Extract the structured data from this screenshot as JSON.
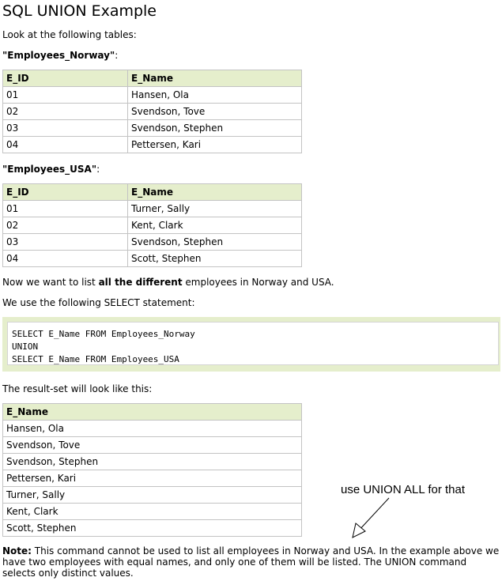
{
  "title": "SQL UNION Example",
  "intro": "Look at the following tables:",
  "table1": {
    "label": "\"Employees_Norway\"",
    "suffix": ":",
    "headers": [
      "E_ID",
      "E_Name"
    ],
    "rows": [
      [
        "01",
        "Hansen, Ola"
      ],
      [
        "02",
        "Svendson, Tove"
      ],
      [
        "03",
        "Svendson, Stephen"
      ],
      [
        "04",
        "Pettersen, Kari"
      ]
    ]
  },
  "table2": {
    "label": "\"Employees_USA\"",
    "suffix": ":",
    "headers": [
      "E_ID",
      "E_Name"
    ],
    "rows": [
      [
        "01",
        "Turner, Sally"
      ],
      [
        "02",
        "Kent, Clark"
      ],
      [
        "03",
        "Svendson, Stephen"
      ],
      [
        "04",
        "Scott, Stephen"
      ]
    ]
  },
  "want": {
    "pre": "Now we want to list ",
    "bold": "all the different",
    "post": " employees in Norway and USA."
  },
  "use_stmt": "We use the following SELECT statement:",
  "code": [
    "SELECT E_Name FROM Employees_Norway",
    "UNION",
    "SELECT E_Name FROM Employees_USA"
  ],
  "result_intro": "The result-set will look like this:",
  "result": {
    "header": "E_Name",
    "rows": [
      "Hansen, Ola",
      "Svendson, Tove",
      "Svendson, Stephen",
      "Pettersen, Kari",
      "Turner, Sally",
      "Kent, Clark",
      "Scott, Stephen"
    ]
  },
  "annotation": "use UNION ALL for that",
  "note": {
    "label": "Note:",
    "text": " This command cannot be used to list all employees in Norway and USA. In the example above we have two employees with equal names, and only one of them will be listed. The UNION command selects only distinct values."
  },
  "colors": {
    "header_bg": "#e5eecc",
    "border": "#c3c3c3"
  }
}
